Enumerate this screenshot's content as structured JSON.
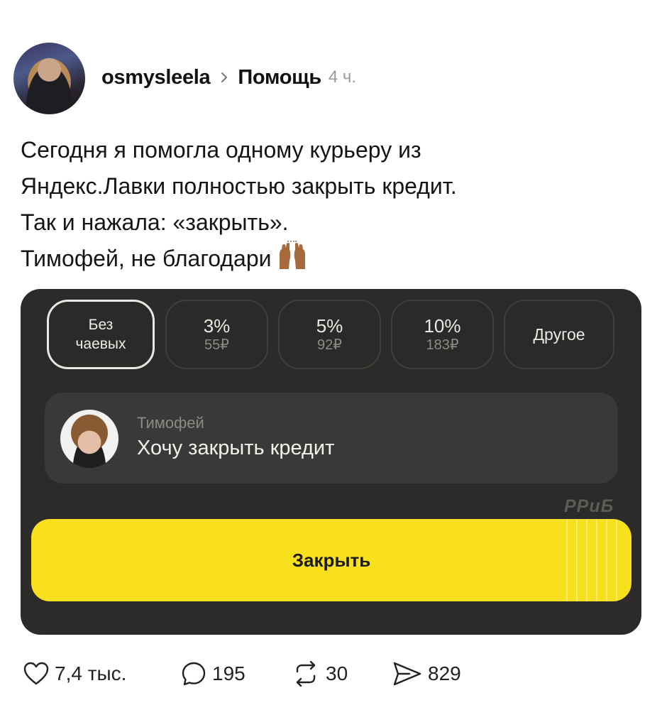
{
  "post": {
    "username": "osmysleela",
    "community": "Помощь",
    "time": "4 ч.",
    "text_lines": [
      "Сегодня я помогла одному курьеру из",
      "Яндекс.Лавки полностью закрыть кредит.",
      "Так и нажала: «закрыть».",
      "Тимофей, не благодари"
    ],
    "emoji": "raising-hands-emoji"
  },
  "embed": {
    "tips": [
      {
        "line1": "Без",
        "line2": "чаевых",
        "selected": true
      },
      {
        "line1": "3%",
        "line2": "55₽",
        "selected": false
      },
      {
        "line1": "5%",
        "line2": "92₽",
        "selected": false
      },
      {
        "line1": "10%",
        "line2": "183₽",
        "selected": false
      },
      {
        "line1": "Другое",
        "line2": "",
        "selected": false
      }
    ],
    "message": {
      "sender": "Тимофей",
      "text": "Хочу закрыть кредит"
    },
    "button_label": "Закрыть",
    "watermark": "РРиБ",
    "colors": {
      "background": "#2c2b29",
      "button": "#f9e01c"
    }
  },
  "actions": {
    "likes": "7,4 тыс.",
    "comments": "195",
    "reposts": "30",
    "shares": "829"
  }
}
